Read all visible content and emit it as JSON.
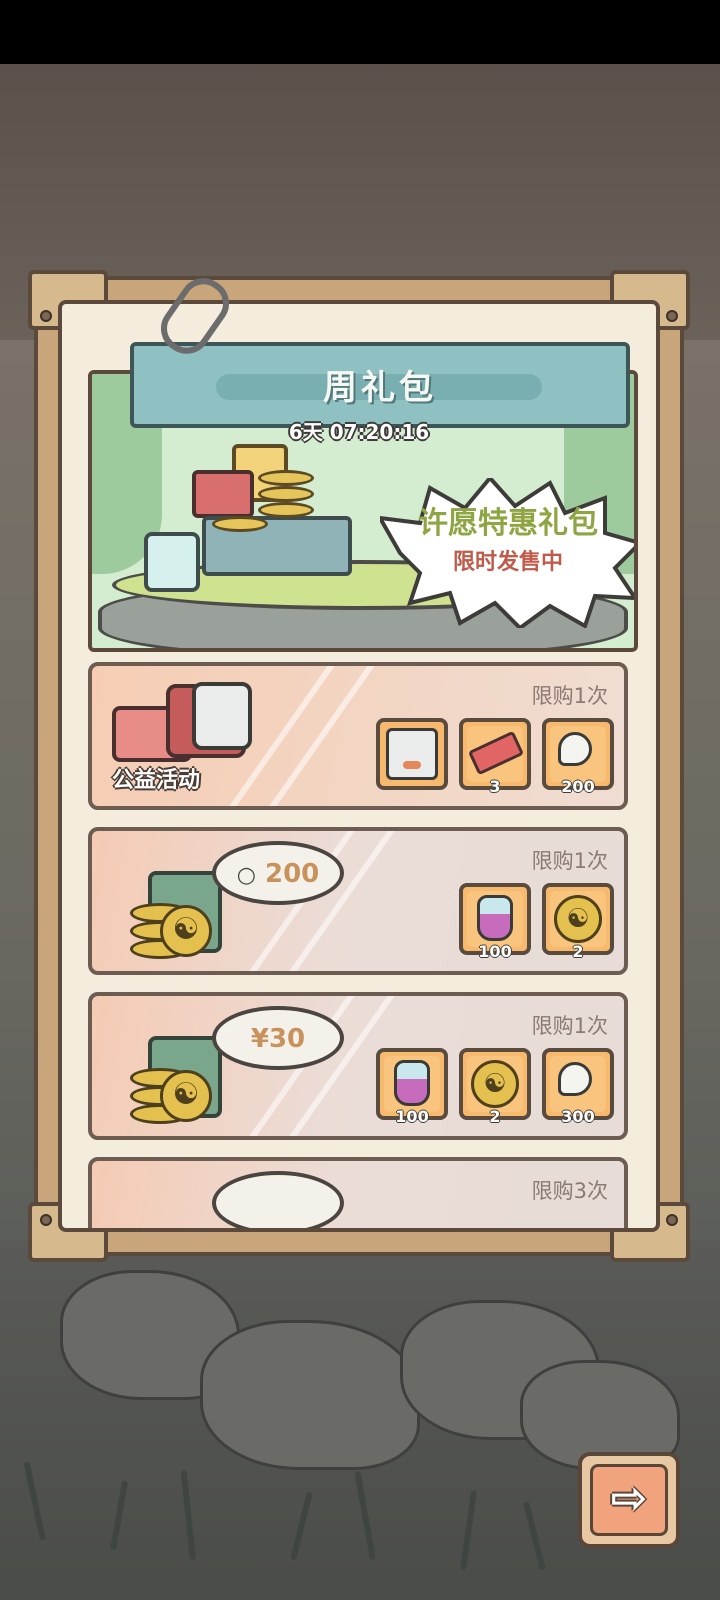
{
  "header": {
    "title": "周礼包",
    "timer": "6天 07:20:16"
  },
  "banner": {
    "title": "许愿特惠礼包",
    "subtitle": "限时发售中"
  },
  "offers": [
    {
      "label": "公益活动",
      "limit": "限购1次",
      "items": [
        {
          "icon": "seal-item-icon",
          "qty": ""
        },
        {
          "icon": "ticket-icon",
          "qty": "3"
        },
        {
          "icon": "ghost-icon",
          "qty": "200"
        }
      ]
    },
    {
      "price": "200",
      "price_icon": "ghost-currency-icon",
      "limit": "限购1次",
      "items": [
        {
          "icon": "potion-icon",
          "qty": "100"
        },
        {
          "icon": "yin-yang-coin-icon",
          "qty": "2"
        }
      ]
    },
    {
      "price": "¥30",
      "limit": "限购1次",
      "items": [
        {
          "icon": "potion-icon",
          "qty": "100"
        },
        {
          "icon": "yin-yang-coin-icon",
          "qty": "2"
        },
        {
          "icon": "ghost-icon",
          "qty": "300"
        }
      ]
    },
    {
      "limit": "限购3次"
    }
  ],
  "navigation": {
    "next_icon": "arrow-right-icon",
    "arrow_glyph": "⇨"
  },
  "colors": {
    "title_plate": "#8fc1c3",
    "banner_title": "#8da642",
    "banner_subtitle": "#c05a4a",
    "item_slot": "#f7b96d"
  }
}
